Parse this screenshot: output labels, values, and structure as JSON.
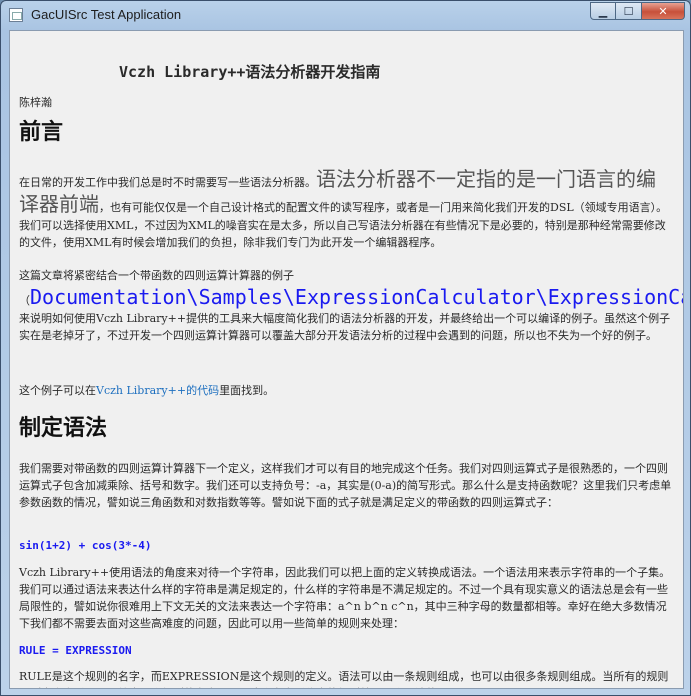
{
  "window": {
    "title": "GacUISrc Test Application",
    "controls": {
      "minimize": "▁",
      "maximize": "☐",
      "close": "✕"
    }
  },
  "doc": {
    "title": "Vczh Library++语法分析器开发指南",
    "author": "陈梓瀚",
    "sections": [
      {
        "heading": "前言",
        "p1_a": "在日常的开发工作中我们总是时不时需要写一些语法分析器。",
        "p1_big": "语法分析器不一定指的是一门语言的编译器前端",
        "p1_b": "，也有可能仅仅是一个自己设计格式的配置文件的读写程序，或者是一门用来简化我们开发的DSL（领域专用语言）。我们可以选择使用XML，不过因为XML的噪音实在是太多，所以自己写语法分析器在有些情况下是必要的，特别是那种经常需要修改的文件，使用XML有时候会增加我们的负担，除非我们专门为此开发一个编辑器程序。",
        "p2_a": "这篇文章将紧密结合一个带函数的四则运算计算器的例子（",
        "p2_path": "Documentation\\Samples\\ExpressionCalculator\\ExpressionCalculator.sln",
        "p2_b": "）来说明如何使用Vczh Library++提供的工具来大幅度简化我们的语法分析器的开发，并最终给出一个可以编译的例子。虽然这个例子实在是老掉牙了，不过开发一个四则运算计算器可以覆盖大部分开发语法分析的过程中会遇到的问题，所以也不失为一个好的例子。",
        "p3_a": "这个例子可以在",
        "p3_link": "Vczh Library++的代码",
        "p3_b": "里面找到。"
      },
      {
        "heading": "制定语法",
        "p1": "我们需要对带函数的四则运算计算器下一个定义，这样我们才可以有目的地完成这个任务。我们对四则运算式子是很熟悉的，一个四则运算式子包含加减乘除、括号和数字。我们还可以支持负号：-a，其实是(0-a)的简写形式。那么什么是支持函数呢？这里我们只考虑单参数函数的情况，譬如说三角函数和对数指数等等。譬如说下面的式子就是满足定义的带函数的四则运算式子：",
        "code1": "sin(1+2) + cos(3*-4)",
        "p2": "Vczh Library++使用语法的角度来对待一个字符串，因此我们可以把上面的定义转换成语法。一个语法用来表示字符串的一个子集。我们可以通过语法来表达什么样的字符串是满足规定的，什么样的字符串是不满足规定的。不过一个具有现实意义的语法总是会有一些局限性的，譬如说你很难用上下文无关的文法来表达一个字符串：a^n b^n c^n，其中三种字母的数量都相等。幸好在绝大多数情况下我们都不需要去面对这些高难度的问题，因此可以用一些简单的规则来处理：",
        "code2": "RULE = EXPRESSION",
        "p3": "RULE是这个规则的名字，而EXPRESSION是这个规则的定义。语法可以由一条规则组成，也可以由很多条规则组成。当所有的规则都列出来之后，只要给出一个规则的名字，那么这个名字所代表的规则就是一个语法的入口。"
      }
    ]
  }
}
